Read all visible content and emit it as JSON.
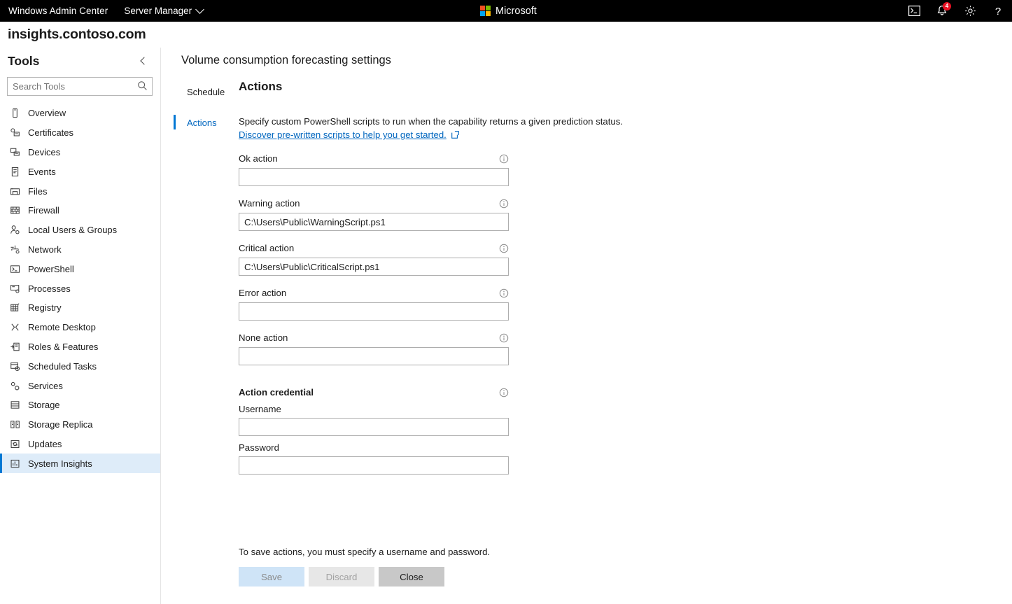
{
  "topbar": {
    "brand": "Windows Admin Center",
    "nav_dropdown": "Server Manager",
    "microsoft_label": "Microsoft",
    "notification_count": "4",
    "accent_color": "#0078d4",
    "badge_color": "#e81123"
  },
  "server": {
    "name": "insights.contoso.com"
  },
  "sidebar": {
    "heading": "Tools",
    "search": {
      "placeholder": "Search Tools",
      "value": ""
    },
    "items": [
      {
        "label": "Overview",
        "icon": "device-icon",
        "selected": false
      },
      {
        "label": "Certificates",
        "icon": "certificate-icon",
        "selected": false
      },
      {
        "label": "Devices",
        "icon": "devices-icon",
        "selected": false
      },
      {
        "label": "Events",
        "icon": "events-log-icon",
        "selected": false
      },
      {
        "label": "Files",
        "icon": "files-folder-icon",
        "selected": false
      },
      {
        "label": "Firewall",
        "icon": "firewall-brick-icon",
        "selected": false
      },
      {
        "label": "Local Users & Groups",
        "icon": "users-icon",
        "selected": false
      },
      {
        "label": "Network",
        "icon": "network-icon",
        "selected": false
      },
      {
        "label": "PowerShell",
        "icon": "powershell-console-icon",
        "selected": false
      },
      {
        "label": "Processes",
        "icon": "processes-icon",
        "selected": false
      },
      {
        "label": "Registry",
        "icon": "registry-grid-icon",
        "selected": false
      },
      {
        "label": "Remote Desktop",
        "icon": "remote-desktop-icon",
        "selected": false
      },
      {
        "label": "Roles & Features",
        "icon": "roles-features-icon",
        "selected": false
      },
      {
        "label": "Scheduled Tasks",
        "icon": "scheduled-tasks-clock-icon",
        "selected": false
      },
      {
        "label": "Services",
        "icon": "services-gear-icon",
        "selected": false
      },
      {
        "label": "Storage",
        "icon": "storage-disk-icon",
        "selected": false
      },
      {
        "label": "Storage Replica",
        "icon": "storage-replica-icon",
        "selected": false
      },
      {
        "label": "Updates",
        "icon": "updates-refresh-icon",
        "selected": false
      },
      {
        "label": "System Insights",
        "icon": "system-insights-chart-icon",
        "selected": true
      }
    ]
  },
  "main": {
    "page_title": "Volume consumption forecasting settings",
    "tabs": [
      {
        "label": "Schedule",
        "active": false
      },
      {
        "label": "Actions",
        "active": true
      }
    ],
    "section_heading": "Actions",
    "description": "Specify custom PowerShell scripts to run when the capability returns a given prediction status.",
    "discover_link": "Discover pre-written scripts to help you get started.",
    "fields": [
      {
        "label": "Ok action",
        "value": "",
        "has_info": true
      },
      {
        "label": "Warning action",
        "value": "C:\\Users\\Public\\WarningScript.ps1",
        "has_info": true
      },
      {
        "label": "Critical action",
        "value": "C:\\Users\\Public\\CriticalScript.ps1",
        "has_info": true
      },
      {
        "label": "Error action",
        "value": "",
        "has_info": true
      },
      {
        "label": "None action",
        "value": "",
        "has_info": true
      }
    ],
    "credential": {
      "heading": "Action credential",
      "username_label": "Username",
      "username_value": "",
      "password_label": "Password",
      "password_value": ""
    },
    "footer": {
      "message": "To save actions, you must specify a username and password.",
      "save_label": "Save",
      "discard_label": "Discard",
      "close_label": "Close"
    }
  }
}
